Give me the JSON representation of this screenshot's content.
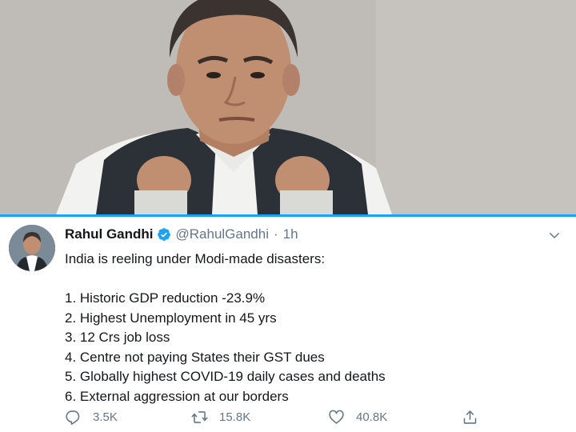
{
  "photo": {
    "icon": "portrait-photo"
  },
  "tweet": {
    "author": {
      "display_name": "Rahul Gandhi",
      "handle": "@RahulGandhi",
      "verified": true,
      "avatar_icon": "avatar-photo"
    },
    "separator": "·",
    "timestamp": "1h",
    "menu_icon": "chevron-down-icon",
    "text_intro": "India is reeling under Modi-made disasters:",
    "list_items": [
      "1. Historic GDP reduction -23.9%",
      "2. Highest Unemployment in 45 yrs",
      "3. 12 Crs job loss",
      "4. Centre not paying States their GST dues",
      "5. Globally highest COVID-19 daily cases and deaths",
      "6. External aggression at our borders"
    ],
    "actions": {
      "reply": {
        "icon": "reply-icon",
        "count": "3.5K"
      },
      "retweet": {
        "icon": "retweet-icon",
        "count": "15.8K"
      },
      "like": {
        "icon": "heart-icon",
        "count": "40.8K"
      },
      "share": {
        "icon": "share-icon"
      }
    }
  },
  "colors": {
    "accent": "#1da1f2",
    "text": "#14171a",
    "secondary": "#657786"
  }
}
